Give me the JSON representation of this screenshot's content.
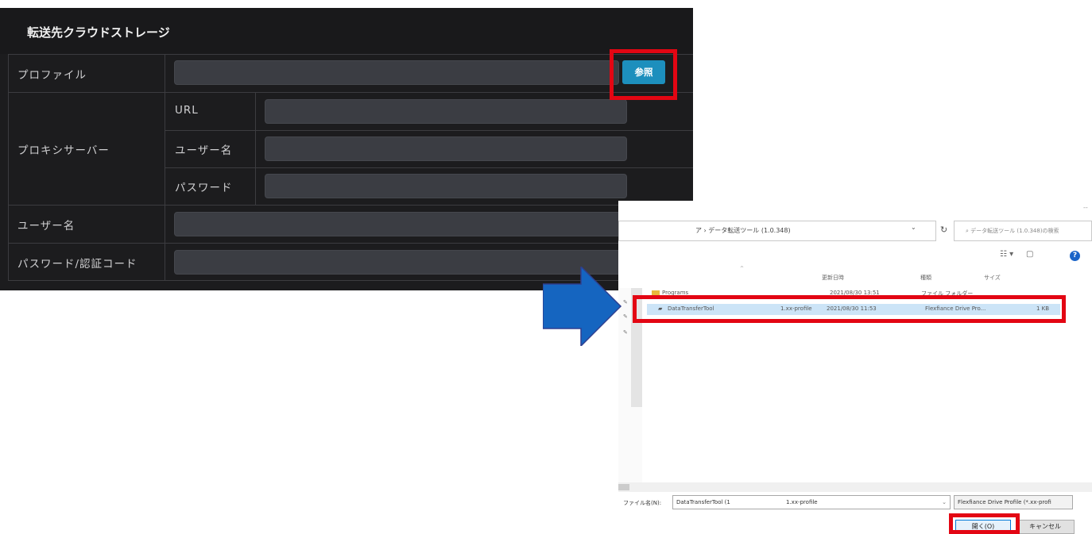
{
  "panel": {
    "title": "転送先クラウドストレージ",
    "profile_label": "プロファイル",
    "browse_button": "参照",
    "proxy_label": "プロキシサーバー",
    "proxy_url_label": "URL",
    "proxy_user_label": "ユーザー名",
    "proxy_password_label": "パスワード",
    "username_label": "ユーザー名",
    "password_label": "パスワード/認証コード"
  },
  "dialog": {
    "address_path": "ア › データ転送ツール (1.0.348)",
    "search_placeholder": "データ転送ツール (1.0.348)の検索",
    "columns": {
      "date": "更新日時",
      "type": "種類",
      "size": "サイズ"
    },
    "rows": [
      {
        "name": "Programs",
        "date": "2021/08/30 13:51",
        "type": "ファイル フォルダー",
        "size": ""
      },
      {
        "name": "DataTransferTool",
        "ext": "1.xx-profile",
        "date": "2021/08/30 11:53",
        "type": "Flexfiance Drive Pro...",
        "size": "1 KB"
      }
    ],
    "filename_label": "ファイル名(N):",
    "filename_value": "DataTransferTool (1",
    "filename_ext": "1.xx-profile",
    "filetype_value": "Flexfiance Drive Profile (*.xx-profi",
    "open_button": "開く(O)",
    "cancel_button": "キャンセル"
  },
  "colors": {
    "panel_bg": "#1c1c1e",
    "accent": "#1d8fbd",
    "highlight": "#e30613",
    "arrow": "#1565c0"
  },
  "icons": [
    "arrow-right-icon",
    "folder-icon",
    "refresh-icon",
    "help-icon",
    "view-icon",
    "chevron-down-icon"
  ]
}
